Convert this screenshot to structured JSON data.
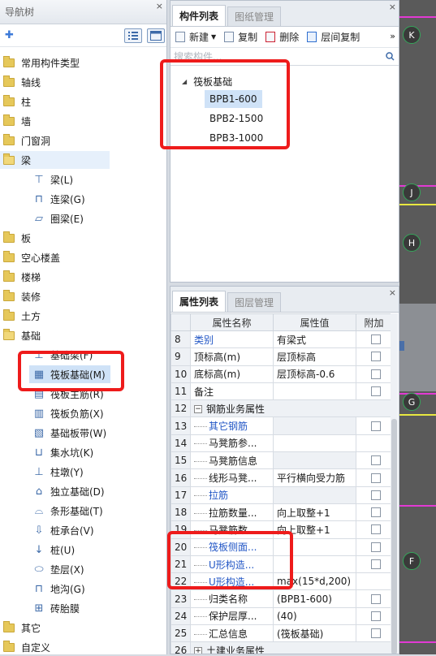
{
  "nav": {
    "title": "导航树",
    "close": "×",
    "items": [
      {
        "label": "常用构件类型"
      },
      {
        "label": "轴线"
      },
      {
        "label": "柱"
      },
      {
        "label": "墙"
      },
      {
        "label": "门窗洞"
      },
      {
        "label": "梁"
      },
      {
        "label": "梁(L)"
      },
      {
        "label": "连梁(G)"
      },
      {
        "label": "圈梁(E)"
      },
      {
        "label": "板"
      },
      {
        "label": "空心楼盖"
      },
      {
        "label": "楼梯"
      },
      {
        "label": "装修"
      },
      {
        "label": "土方"
      },
      {
        "label": "基础"
      },
      {
        "label": "基础梁(F)"
      },
      {
        "label": "筏板基础(M)"
      },
      {
        "label": "筏板主筋(R)"
      },
      {
        "label": "筏板负筋(X)"
      },
      {
        "label": "基础板带(W)"
      },
      {
        "label": "集水坑(K)"
      },
      {
        "label": "柱墩(Y)"
      },
      {
        "label": "独立基础(D)"
      },
      {
        "label": "条形基础(T)"
      },
      {
        "label": "桩承台(V)"
      },
      {
        "label": "桩(U)"
      },
      {
        "label": "垫层(X)"
      },
      {
        "label": "地沟(G)"
      },
      {
        "label": "砖胎膜"
      },
      {
        "label": "其它"
      },
      {
        "label": "自定义"
      }
    ]
  },
  "comp": {
    "tabs": [
      "构件列表",
      "图纸管理"
    ],
    "toolbar": {
      "new": "新建",
      "copy": "复制",
      "delete": "删除",
      "floor_copy": "层间复制",
      "more": "»"
    },
    "search_placeholder": "搜索构件...",
    "group": "筏板基础",
    "items": [
      "BPB1-600",
      "BPB2-1500",
      "BPB3-1000"
    ]
  },
  "props": {
    "tabs": [
      "属性列表",
      "图层管理"
    ],
    "headers": [
      "属性名称",
      "属性值",
      "附加"
    ],
    "rows": [
      {
        "n": "8",
        "name": "类别",
        "value": "有梁式"
      },
      {
        "n": "9",
        "name": "顶标高(m)",
        "value": "层顶标高"
      },
      {
        "n": "10",
        "name": "底标高(m)",
        "value": "层顶标高-0.6"
      },
      {
        "n": "11",
        "name": "备注",
        "value": ""
      },
      {
        "n": "12",
        "name": "钢筋业务属性",
        "value": ""
      },
      {
        "n": "13",
        "name": "其它钢筋",
        "value": ""
      },
      {
        "n": "14",
        "name": "马凳筋参...",
        "value": ""
      },
      {
        "n": "15",
        "name": "马凳筋信息",
        "value": ""
      },
      {
        "n": "16",
        "name": "线形马凳...",
        "value": "平行横向受力筋"
      },
      {
        "n": "17",
        "name": "拉筋",
        "value": ""
      },
      {
        "n": "18",
        "name": "拉筋数量...",
        "value": "向上取整+1"
      },
      {
        "n": "19",
        "name": "马凳筋数...",
        "value": "向上取整+1"
      },
      {
        "n": "20",
        "name": "筏板侧面...",
        "value": ""
      },
      {
        "n": "21",
        "name": "U形构造...",
        "value": ""
      },
      {
        "n": "22",
        "name": "U形构造...",
        "value": "max(15*d,200)"
      },
      {
        "n": "23",
        "name": "归类名称",
        "value": "(BPB1-600)"
      },
      {
        "n": "24",
        "name": "保护层厚...",
        "value": "(40)"
      },
      {
        "n": "25",
        "name": "汇总信息",
        "value": "(筏板基础)"
      },
      {
        "n": "26",
        "name": "土建业务属性",
        "value": ""
      }
    ],
    "tree_toggle_open": "−",
    "tree_toggle_closed": "+"
  },
  "canvas": {
    "axes": [
      "K",
      "J",
      "H",
      "G",
      "F"
    ]
  }
}
